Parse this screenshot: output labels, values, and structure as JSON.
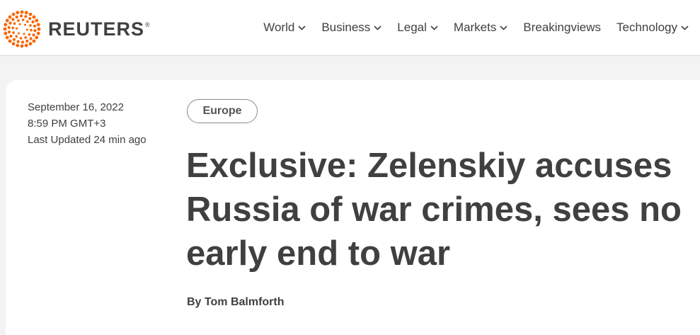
{
  "header": {
    "brand": "REUTERS",
    "registered_mark": "®",
    "brand_color": "#fa6400",
    "nav": [
      {
        "label": "World",
        "has_dropdown": true
      },
      {
        "label": "Business",
        "has_dropdown": true
      },
      {
        "label": "Legal",
        "has_dropdown": true
      },
      {
        "label": "Markets",
        "has_dropdown": true
      },
      {
        "label": "Breakingviews",
        "has_dropdown": false
      },
      {
        "label": "Technology",
        "has_dropdown": true
      }
    ]
  },
  "article": {
    "date": "September 16, 2022",
    "time": "8:59 PM GMT+3",
    "updated": "Last Updated 24 min ago",
    "section_tag": "Europe",
    "headline": "Exclusive: Zelenskiy accuses Russia of war crimes, sees no early end to war",
    "byline_prefix": "By",
    "author": "Tom Balmforth"
  }
}
